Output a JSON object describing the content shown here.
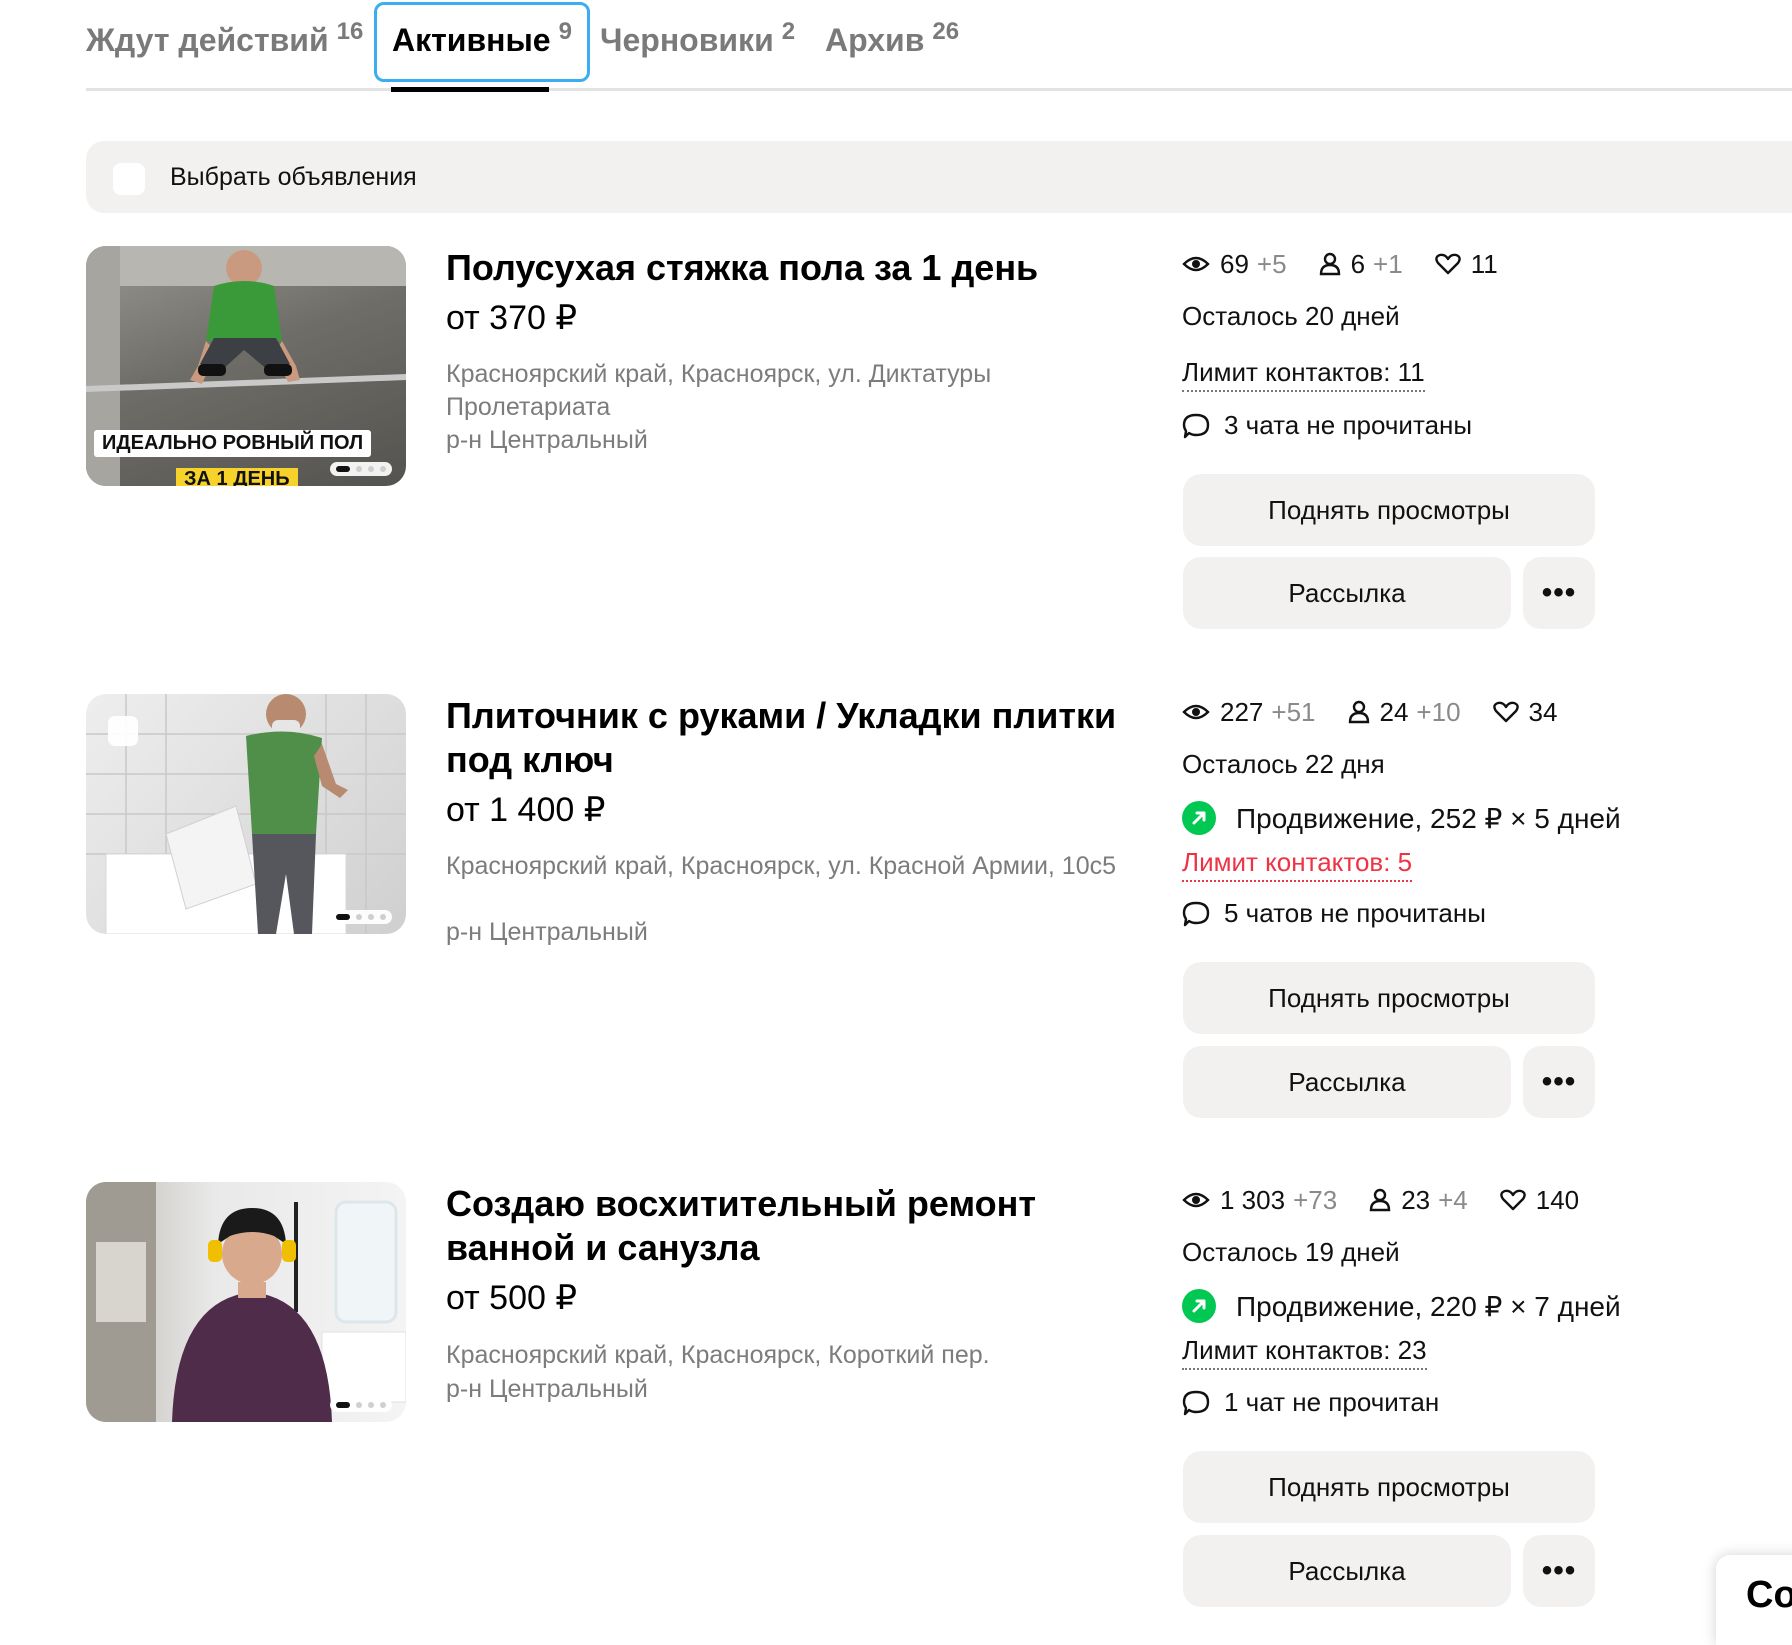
{
  "tabs": [
    {
      "label": "Ждут действий",
      "count": "16"
    },
    {
      "label": "Активные",
      "count": "9"
    },
    {
      "label": "Черновики",
      "count": "2"
    },
    {
      "label": "Архив",
      "count": "26"
    }
  ],
  "select_all_label": "Выбрать объявления",
  "listings": [
    {
      "title": "Полусухая стяжка пола за 1 день",
      "price": "от 370 ₽",
      "address": "Красноярский край, Красноярск, ул. Диктатуры Пролетариата",
      "district": "р-н Центральный",
      "photo_text_1": "ИДЕАЛЬНО РОВНЫЙ ПОЛ",
      "photo_text_2": "ЗА 1 ДЕНЬ",
      "views": "69",
      "views_delta": "+5",
      "contacts": "6",
      "contacts_delta": "+1",
      "favorites": "11",
      "days_left": "Осталось 20 дней",
      "contact_limit": "Лимит контактов: 11",
      "unread": "3 чата не прочитаны",
      "raise_button": "Поднять просмотры",
      "mail_button": "Рассылка",
      "more_button": "•••"
    },
    {
      "title": "Плиточник с руками / Укладки плитки под ключ",
      "price": "от 1 400 ₽",
      "address": "Красноярский край, Красноярск, ул. Красной Армии, 10с5",
      "district": "р-н Центральный",
      "views": "227",
      "views_delta": "+51",
      "contacts": "24",
      "contacts_delta": "+10",
      "favorites": "34",
      "days_left": "Осталось 22 дня",
      "promotion": "Продвижение, 252 ₽ × 5 дней",
      "contact_limit": "Лимит контактов: 5",
      "contact_limit_color": "#ee3344",
      "unread": "5 чатов не прочитаны",
      "raise_button": "Поднять просмотры",
      "mail_button": "Рассылка",
      "more_button": "•••"
    },
    {
      "title": "Создаю восхитительный ремонт ванной и санузла",
      "price": "от 500 ₽",
      "address": "Красноярский край, Красноярск, Короткий пер.",
      "district": "р-н Центральный",
      "views": "1 303",
      "views_delta": "+73",
      "contacts": "23",
      "contacts_delta": "+4",
      "favorites": "140",
      "days_left": "Осталось 19 дней",
      "promotion": "Продвижение, 220 ₽ × 7 дней",
      "contact_limit": "Лимит контактов: 23",
      "unread": "1 чат не прочитан",
      "raise_button": "Поднять просмотры",
      "mail_button": "Рассылка",
      "more_button": "•••"
    }
  ],
  "corner_widget_text": "Co",
  "colors": {
    "accent_focus": "#3aaef0",
    "promo_green": "#00c853",
    "warning_red": "#ee3344",
    "button_bg": "#f2f1f0"
  },
  "icons": [
    "eye-icon",
    "person-icon",
    "heart-icon",
    "chat-bubble-icon",
    "promotion-arrow-icon"
  ]
}
